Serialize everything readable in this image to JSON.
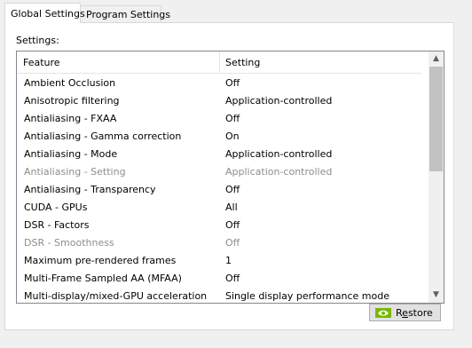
{
  "tabs": [
    {
      "label": "Global Settings",
      "active": true
    },
    {
      "label": "Program Settings",
      "active": false
    }
  ],
  "settings_label": "Settings:",
  "columns": {
    "feature": "Feature",
    "setting": "Setting"
  },
  "rows": [
    {
      "feature": "Ambient Occlusion",
      "setting": "Off",
      "disabled": false
    },
    {
      "feature": "Anisotropic filtering",
      "setting": "Application-controlled",
      "disabled": false
    },
    {
      "feature": "Antialiasing - FXAA",
      "setting": "Off",
      "disabled": false
    },
    {
      "feature": "Antialiasing - Gamma correction",
      "setting": "On",
      "disabled": false
    },
    {
      "feature": "Antialiasing - Mode",
      "setting": "Application-controlled",
      "disabled": false
    },
    {
      "feature": "Antialiasing - Setting",
      "setting": "Application-controlled",
      "disabled": true
    },
    {
      "feature": "Antialiasing - Transparency",
      "setting": "Off",
      "disabled": false
    },
    {
      "feature": "CUDA - GPUs",
      "setting": "All",
      "disabled": false
    },
    {
      "feature": "DSR - Factors",
      "setting": "Off",
      "disabled": false
    },
    {
      "feature": "DSR - Smoothness",
      "setting": "Off",
      "disabled": true
    },
    {
      "feature": "Maximum pre-rendered frames",
      "setting": "1",
      "disabled": false
    },
    {
      "feature": "Multi-Frame Sampled AA (MFAA)",
      "setting": "Off",
      "disabled": false
    },
    {
      "feature": "Multi-display/mixed-GPU acceleration",
      "setting": "Single display performance mode",
      "disabled": false
    }
  ],
  "restore_button": {
    "label_prefix": "R",
    "label_underlined": "e",
    "label_suffix": "store"
  },
  "colors": {
    "nvidia_green": "#76b900",
    "disabled_text": "#8d8d8d"
  }
}
